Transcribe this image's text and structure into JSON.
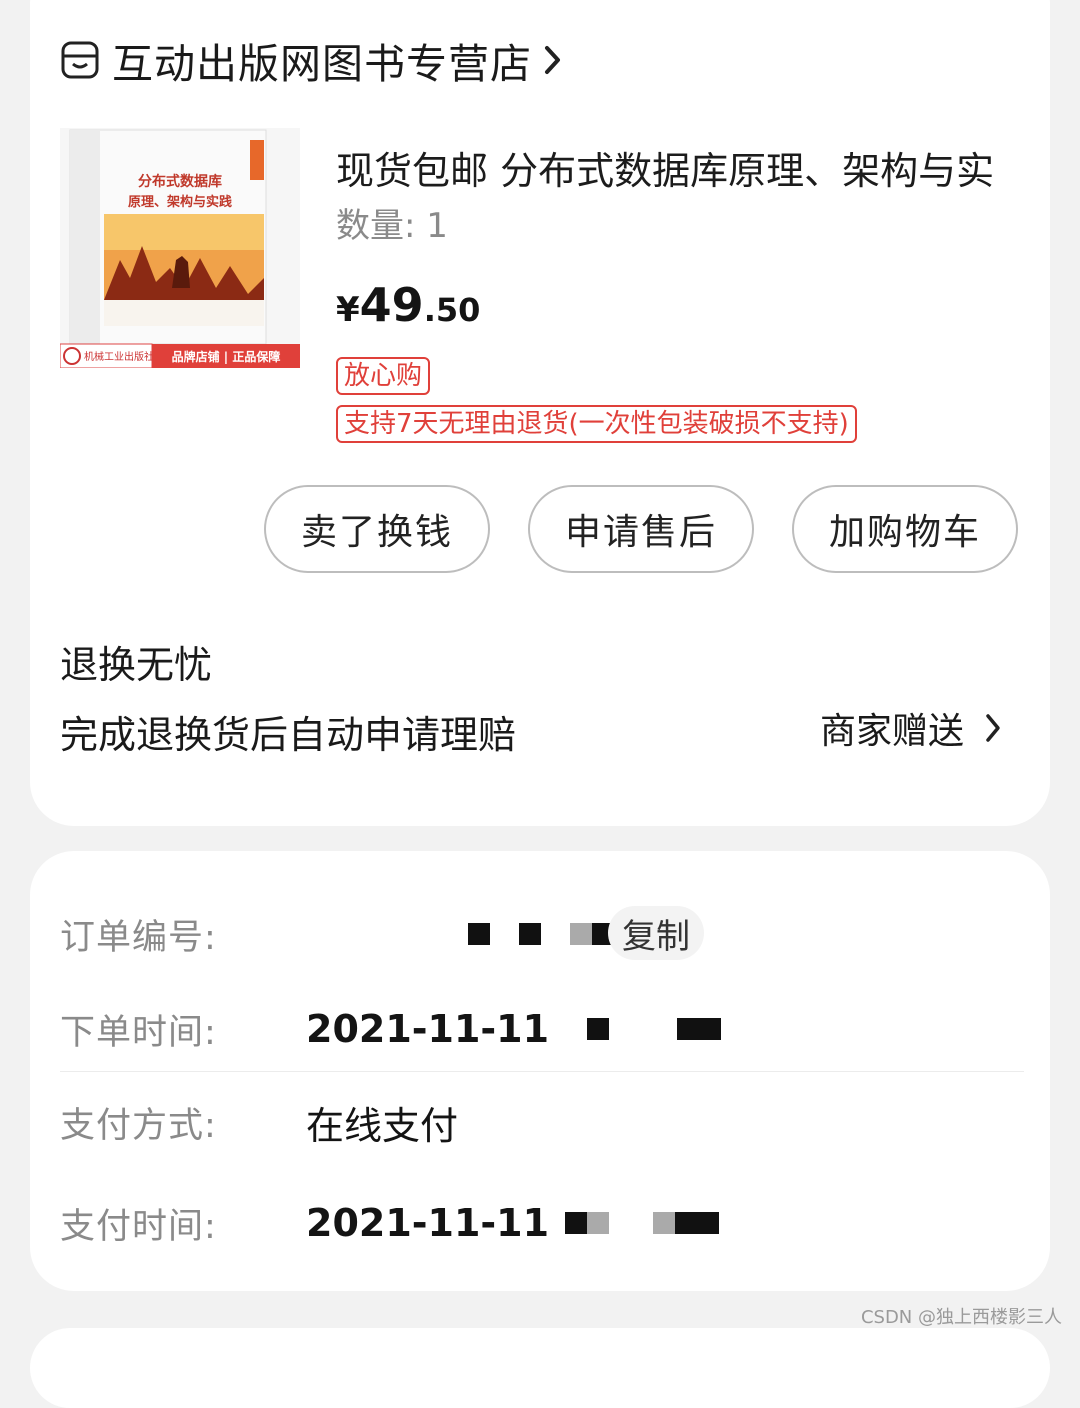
{
  "shop": {
    "name": "互动出版网图书专营店",
    "icon": "shop-icon"
  },
  "product": {
    "title": "现货包邮 分布式数据库原理、架构与实",
    "quantity_label": "数量: 1",
    "price_currency": "¥",
    "price_int": "49",
    "price_decimal": ".50",
    "tag_assurance": "放心购",
    "tag_return": "支持7天无理由退货(一次性包装破损不支持)",
    "cover": {
      "title_line1": "分布式数据库",
      "title_line2": "原理、架构与实践",
      "publisher": "机械工业出版社",
      "badge": "品牌店铺 | 正品保障"
    }
  },
  "actions": {
    "sell": "卖了换钱",
    "after_sale": "申请售后",
    "add_cart": "加购物车"
  },
  "worry_free": {
    "title": "退换无忧",
    "description": "完成退换货后自动申请理赔",
    "gift": "商家赠送"
  },
  "order": {
    "number_label": "订单编号:",
    "copy": "复制",
    "placed_label": "下单时间:",
    "placed_value": "2021-11-11",
    "payment_method_label": "支付方式:",
    "payment_method_value": "在线支付",
    "paid_label": "支付时间:",
    "paid_value": "2021-11-11"
  },
  "watermark": "CSDN @独上西楼影三人",
  "colors": {
    "accent_red": "#e0403a",
    "background": "#f2f2f2",
    "card": "#ffffff"
  }
}
